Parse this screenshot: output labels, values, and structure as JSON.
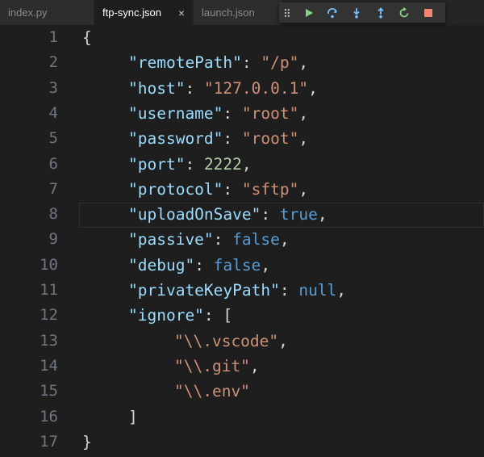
{
  "tabs": [
    {
      "label": "index.py",
      "active": false
    },
    {
      "label": "ftp-sync.json",
      "active": true,
      "close": "×"
    },
    {
      "label": "launch.json",
      "active": false
    }
  ],
  "debug_toolbar": {
    "buttons": [
      {
        "name": "continue-icon",
        "color": "#89d185"
      },
      {
        "name": "step-over-icon",
        "color": "#75beff"
      },
      {
        "name": "step-into-icon",
        "color": "#75beff"
      },
      {
        "name": "step-out-icon",
        "color": "#75beff"
      },
      {
        "name": "restart-icon",
        "color": "#89d185"
      },
      {
        "name": "stop-icon",
        "color": "#f48771"
      }
    ]
  },
  "editor": {
    "current_line": 8,
    "line_numbers": [
      "1",
      "2",
      "3",
      "4",
      "5",
      "6",
      "7",
      "8",
      "9",
      "10",
      "11",
      "12",
      "13",
      "14",
      "15",
      "16",
      "17"
    ],
    "lines": [
      [
        {
          "t": "{",
          "c": "p"
        }
      ],
      [
        {
          "t": "\"remotePath\"",
          "c": "k"
        },
        {
          "t": ": ",
          "c": "p"
        },
        {
          "t": "\"/p\"",
          "c": "s"
        },
        {
          "t": ",",
          "c": "p"
        }
      ],
      [
        {
          "t": "\"host\"",
          "c": "k"
        },
        {
          "t": ": ",
          "c": "p"
        },
        {
          "t": "\"127.0.0.1\"",
          "c": "s"
        },
        {
          "t": ",",
          "c": "p"
        }
      ],
      [
        {
          "t": "\"username\"",
          "c": "k"
        },
        {
          "t": ": ",
          "c": "p"
        },
        {
          "t": "\"root\"",
          "c": "s"
        },
        {
          "t": ",",
          "c": "p"
        }
      ],
      [
        {
          "t": "\"password\"",
          "c": "k"
        },
        {
          "t": ": ",
          "c": "p"
        },
        {
          "t": "\"root\"",
          "c": "s"
        },
        {
          "t": ",",
          "c": "p"
        }
      ],
      [
        {
          "t": "\"port\"",
          "c": "k"
        },
        {
          "t": ": ",
          "c": "p"
        },
        {
          "t": "2222",
          "c": "n"
        },
        {
          "t": ",",
          "c": "p"
        }
      ],
      [
        {
          "t": "\"protocol\"",
          "c": "k"
        },
        {
          "t": ": ",
          "c": "p"
        },
        {
          "t": "\"sftp\"",
          "c": "s"
        },
        {
          "t": ",",
          "c": "p"
        }
      ],
      [
        {
          "t": "\"uploadOnSave\"",
          "c": "k"
        },
        {
          "t": ": ",
          "c": "p"
        },
        {
          "t": "true",
          "c": "b"
        },
        {
          "t": ",",
          "c": "p"
        }
      ],
      [
        {
          "t": "\"passive\"",
          "c": "k"
        },
        {
          "t": ": ",
          "c": "p"
        },
        {
          "t": "false",
          "c": "b"
        },
        {
          "t": ",",
          "c": "p"
        }
      ],
      [
        {
          "t": "\"debug\"",
          "c": "k"
        },
        {
          "t": ": ",
          "c": "p"
        },
        {
          "t": "false",
          "c": "b"
        },
        {
          "t": ",",
          "c": "p"
        }
      ],
      [
        {
          "t": "\"privateKeyPath\"",
          "c": "k"
        },
        {
          "t": ": ",
          "c": "p"
        },
        {
          "t": "null",
          "c": "b"
        },
        {
          "t": ",",
          "c": "p"
        }
      ],
      [
        {
          "t": "\"ignore\"",
          "c": "k"
        },
        {
          "t": ": [",
          "c": "p"
        }
      ],
      [
        {
          "t": "\"\\\\.vscode\"",
          "c": "s"
        },
        {
          "t": ",",
          "c": "p"
        }
      ],
      [
        {
          "t": "\"\\\\.git\"",
          "c": "s"
        },
        {
          "t": ",",
          "c": "p"
        }
      ],
      [
        {
          "t": "\"\\\\.env\"",
          "c": "s"
        }
      ],
      [
        {
          "t": "]",
          "c": "p"
        }
      ],
      [
        {
          "t": "}",
          "c": "p"
        }
      ]
    ]
  }
}
